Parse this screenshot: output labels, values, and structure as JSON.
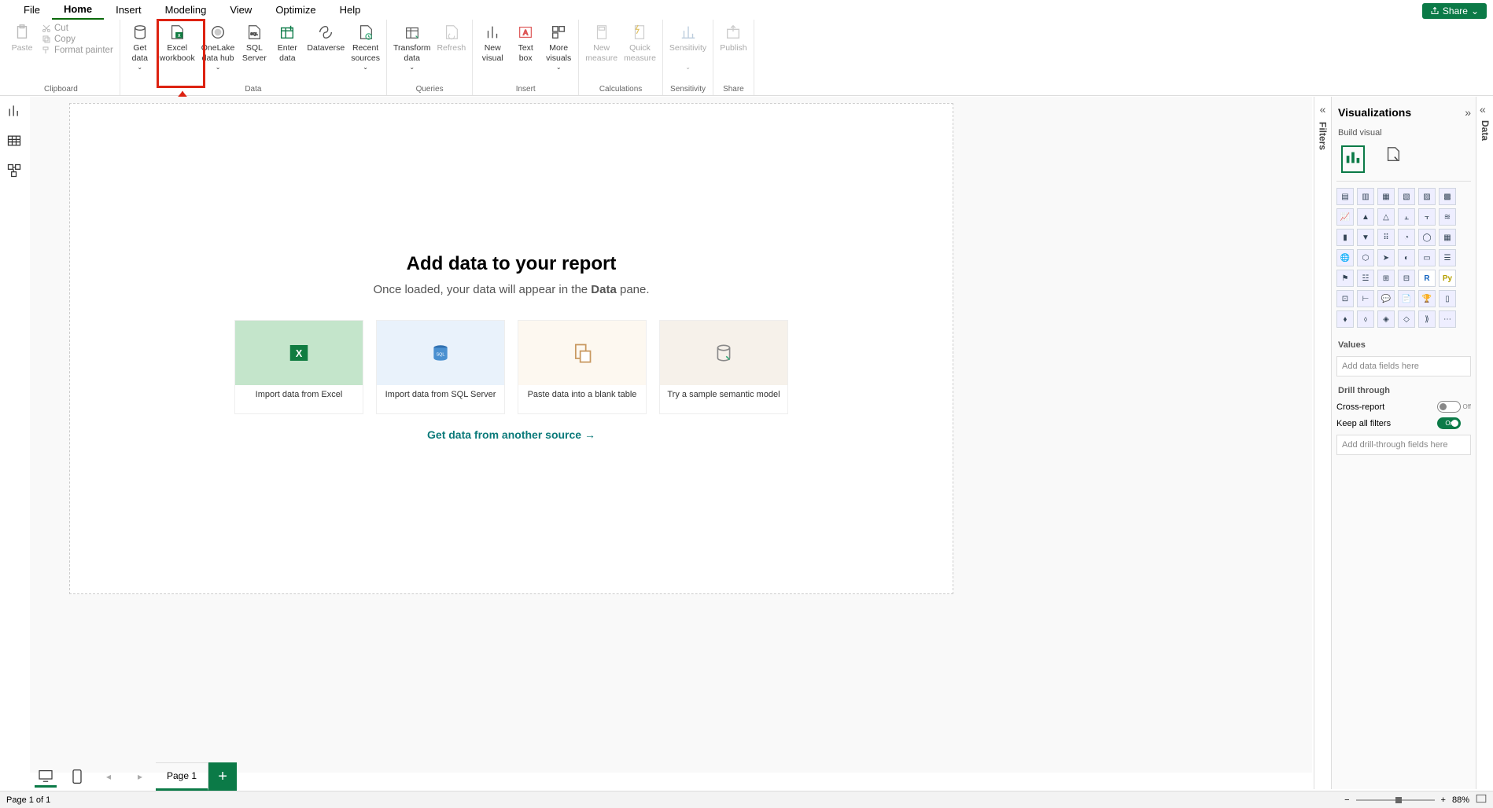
{
  "menubar": {
    "tabs": [
      "File",
      "Home",
      "Insert",
      "Modeling",
      "View",
      "Optimize",
      "Help"
    ],
    "active": 1
  },
  "share": {
    "label": "Share"
  },
  "ribbon": {
    "clipboard": {
      "label": "Clipboard",
      "paste": "Paste",
      "cut": "Cut",
      "copy": "Copy",
      "format": "Format painter"
    },
    "data": {
      "label": "Data",
      "get": "Get\ndata",
      "excel": "Excel\nworkbook",
      "onelake": "OneLake\ndata hub",
      "sql": "SQL\nServer",
      "enter": "Enter\ndata",
      "dataverse": "Dataverse",
      "recent": "Recent\nsources"
    },
    "queries": {
      "label": "Queries",
      "transform": "Transform\ndata",
      "refresh": "Refresh"
    },
    "insert": {
      "label": "Insert",
      "newvisual": "New\nvisual",
      "textbox": "Text\nbox",
      "morevisuals": "More\nvisuals"
    },
    "calc": {
      "label": "Calculations",
      "newmeasure": "New\nmeasure",
      "quick": "Quick\nmeasure"
    },
    "sens": {
      "label": "Sensitivity",
      "btn": "Sensitivity"
    },
    "share": {
      "label": "Share",
      "publish": "Publish"
    }
  },
  "canvas": {
    "title": "Add data to your report",
    "subtitle_pre": "Once loaded, your data will appear in the ",
    "subtitle_bold": "Data",
    "subtitle_post": " pane.",
    "cards": [
      {
        "label": "Import data from Excel"
      },
      {
        "label": "Import data from SQL Server"
      },
      {
        "label": "Paste data into a blank table"
      },
      {
        "label": "Try a sample semantic model"
      }
    ],
    "morelink": "Get data from another source →"
  },
  "pagetabs": {
    "page": "Page 1"
  },
  "statusbar": {
    "page": "Page 1 of 1",
    "zoom": "88%"
  },
  "filters": {
    "title": "Filters"
  },
  "viz": {
    "title": "Visualizations",
    "sub": "Build visual",
    "values": "Values",
    "valph": "Add data fields here",
    "drill": "Drill through",
    "cross": "Cross-report",
    "keep": "Keep all filters",
    "drillph": "Add drill-through fields here",
    "crossState": "Off",
    "keepState": "On"
  },
  "datapanel": {
    "title": "Data"
  }
}
